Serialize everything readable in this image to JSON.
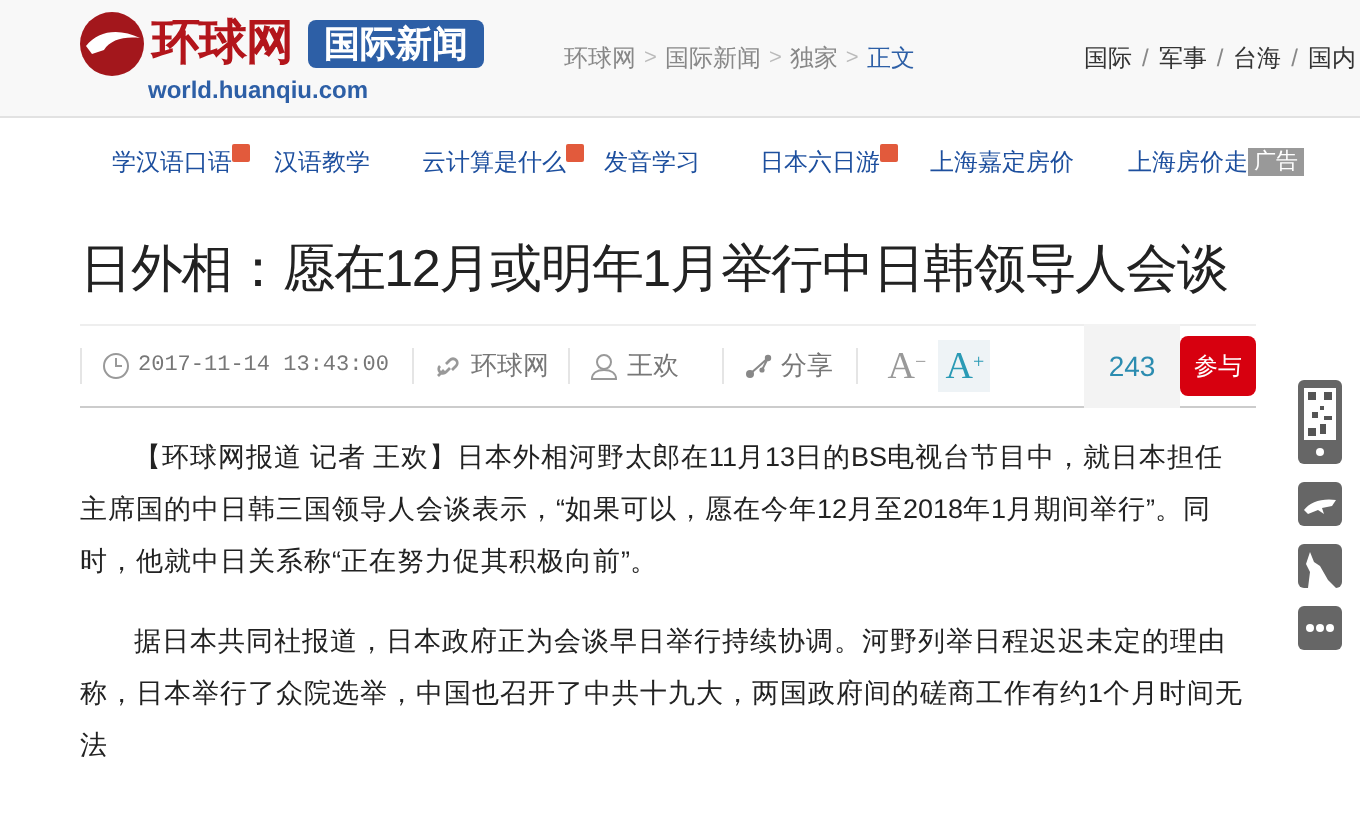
{
  "header": {
    "logo_text": "环球网",
    "channel_badge": "国际新闻",
    "site_url": "world.huanqiu.com",
    "breadcrumb": [
      "环球网",
      "国际新闻",
      "独家",
      "正文"
    ],
    "separator": ">",
    "top_nav": [
      "国际",
      "军事",
      "台海",
      "国内"
    ],
    "top_nav_separator": "/"
  },
  "ad_links": [
    {
      "label": "学汉语口语",
      "hot": true
    },
    {
      "label": "汉语教学",
      "hot": false
    },
    {
      "label": "云计算是什么",
      "hot": true
    },
    {
      "label": "发音学习",
      "hot": false
    },
    {
      "label": "日本六日游",
      "hot": true
    },
    {
      "label": "上海嘉定房价",
      "hot": false
    },
    {
      "label": "上海房价走",
      "hot": false
    }
  ],
  "ad_badge": "广告",
  "article": {
    "title": "日外相：愿在12月或明年1月举行中日韩领导人会谈",
    "meta": {
      "time": "2017-11-14 13:43:00",
      "source": "环球网",
      "author": "王欢",
      "share": "分享",
      "font_smaller": "A",
      "font_smaller_mark": "−",
      "font_larger": "A",
      "font_larger_mark": "+",
      "comment_count": "243",
      "join_button": "参与"
    },
    "paragraphs": [
      "【环球网报道 记者 王欢】日本外相河野太郎在11月13日的BS电视台节目中，就日本担任主席国的中日韩三国领导人会谈表示，“如果可以，愿在今年12月至2018年1月期间举行”。同时，他就中日关系称“正在努力促其积极向前”。",
      "据日本共同社报道，日本政府正为会谈早日举行持续协调。河野列举日程迟迟未定的理由称，日本举行了众院选举，中国也召开了中共十九大，两国政府间的磋商工作有约1个月时间无法"
    ]
  }
}
